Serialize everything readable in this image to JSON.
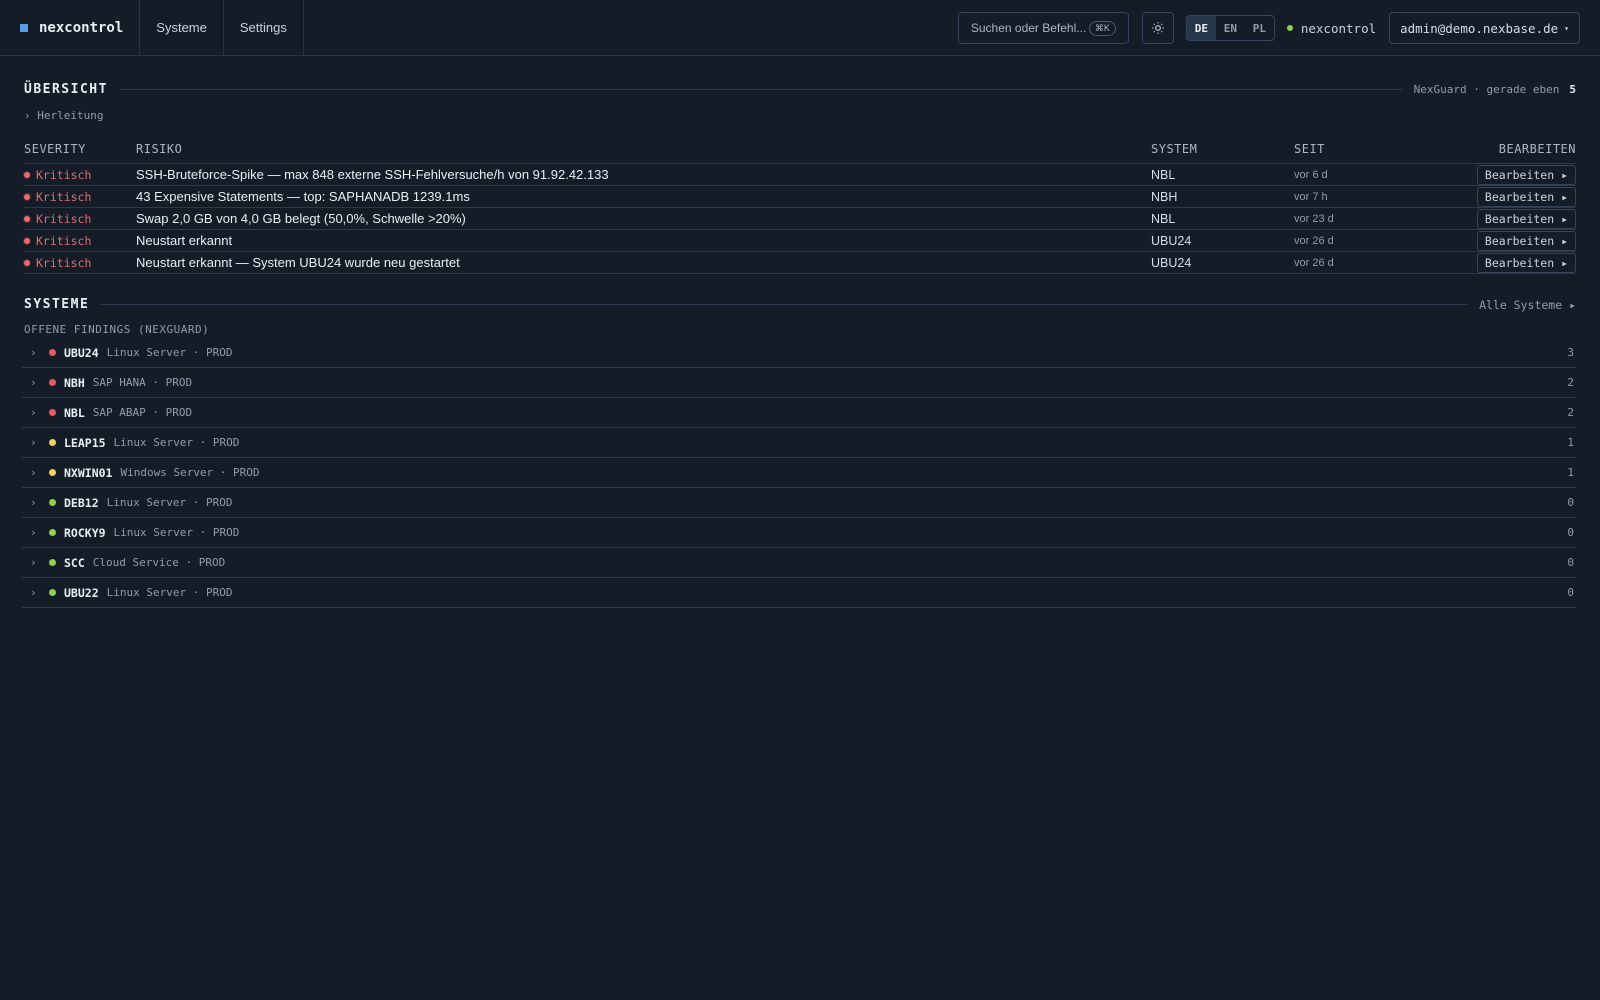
{
  "app": {
    "name": "nexcontrol"
  },
  "nav": [
    {
      "label": "Systeme"
    },
    {
      "label": "Settings"
    }
  ],
  "header": {
    "search_placeholder": "Suchen oder Befehl...",
    "search_shortcut": "⌘K",
    "theme_icon": "sun-icon",
    "languages": [
      {
        "code": "DE",
        "active": true
      },
      {
        "code": "EN",
        "active": false
      },
      {
        "code": "PL",
        "active": false
      }
    ],
    "status_label": "nexcontrol",
    "status_color": "#8fd14f",
    "user": "admin@demo.nexbase.de",
    "user_caret": "▾"
  },
  "overview": {
    "title": "ÜBERSICHT",
    "source": "NexGuard · gerade eben",
    "count": "5",
    "herleitung": "› Herleitung",
    "columns": {
      "severity": "SEVERITY",
      "risk": "RISIKO",
      "system": "SYSTEM",
      "since": "SEIT",
      "edit": "BEARBEITEN"
    },
    "rows": [
      {
        "severity": "Kritisch",
        "risk": "SSH-Bruteforce-Spike — max 848 externe SSH-Fehlversuche/h von 91.92.42.133",
        "system": "NBL",
        "since": "vor 6 d",
        "edit": "Bearbeiten ▸"
      },
      {
        "severity": "Kritisch",
        "risk": "43 Expensive Statements — top: SAPHANADB 1239.1ms",
        "system": "NBH",
        "since": "vor 7 h",
        "edit": "Bearbeiten ▸"
      },
      {
        "severity": "Kritisch",
        "risk": "Swap 2,0 GB von 4,0 GB belegt (50,0%, Schwelle >20%)",
        "system": "NBL",
        "since": "vor 23 d",
        "edit": "Bearbeiten ▸"
      },
      {
        "severity": "Kritisch",
        "risk": "Neustart erkannt",
        "system": "UBU24",
        "since": "vor 26 d",
        "edit": "Bearbeiten ▸"
      },
      {
        "severity": "Kritisch",
        "risk": "Neustart erkannt — System UBU24 wurde neu gestartet",
        "system": "UBU24",
        "since": "vor 26 d",
        "edit": "Bearbeiten ▸"
      }
    ]
  },
  "systems": {
    "title": "SYSTEME",
    "all_link": "Alle Systeme ▸",
    "subtitle": "OFFENE FINDINGS (NEXGUARD)",
    "colors": {
      "red": "#e15b64",
      "yellow": "#f0d060",
      "green": "#8fd14f"
    },
    "items": [
      {
        "name": "UBU24",
        "desc": "Linux Server · PROD",
        "count": "3",
        "status": "red"
      },
      {
        "name": "NBH",
        "desc": "SAP HANA · PROD",
        "count": "2",
        "status": "red"
      },
      {
        "name": "NBL",
        "desc": "SAP ABAP · PROD",
        "count": "2",
        "status": "red"
      },
      {
        "name": "LEAP15",
        "desc": "Linux Server · PROD",
        "count": "1",
        "status": "yellow"
      },
      {
        "name": "NXWIN01",
        "desc": "Windows Server · PROD",
        "count": "1",
        "status": "yellow"
      },
      {
        "name": "DEB12",
        "desc": "Linux Server · PROD",
        "count": "0",
        "status": "green"
      },
      {
        "name": "ROCKY9",
        "desc": "Linux Server · PROD",
        "count": "0",
        "status": "green"
      },
      {
        "name": "SCC",
        "desc": "Cloud Service · PROD",
        "count": "0",
        "status": "green"
      },
      {
        "name": "UBU22",
        "desc": "Linux Server · PROD",
        "count": "0",
        "status": "green"
      }
    ]
  }
}
